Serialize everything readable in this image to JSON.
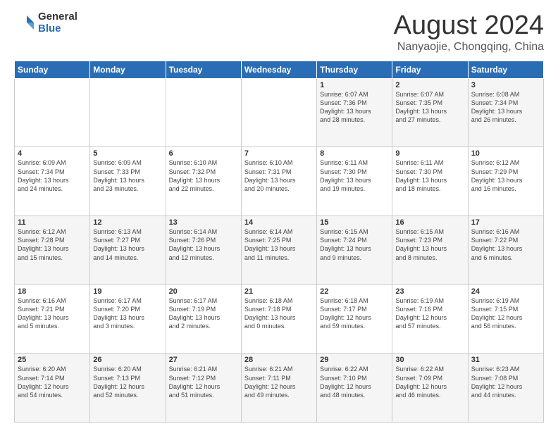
{
  "logo": {
    "general": "General",
    "blue": "Blue"
  },
  "header": {
    "month": "August 2024",
    "location": "Nanyaojie, Chongqing, China"
  },
  "weekdays": [
    "Sunday",
    "Monday",
    "Tuesday",
    "Wednesday",
    "Thursday",
    "Friday",
    "Saturday"
  ],
  "weeks": [
    [
      {
        "day": "",
        "info": ""
      },
      {
        "day": "",
        "info": ""
      },
      {
        "day": "",
        "info": ""
      },
      {
        "day": "",
        "info": ""
      },
      {
        "day": "1",
        "info": "Sunrise: 6:07 AM\nSunset: 7:36 PM\nDaylight: 13 hours\nand 28 minutes."
      },
      {
        "day": "2",
        "info": "Sunrise: 6:07 AM\nSunset: 7:35 PM\nDaylight: 13 hours\nand 27 minutes."
      },
      {
        "day": "3",
        "info": "Sunrise: 6:08 AM\nSunset: 7:34 PM\nDaylight: 13 hours\nand 26 minutes."
      }
    ],
    [
      {
        "day": "4",
        "info": "Sunrise: 6:09 AM\nSunset: 7:34 PM\nDaylight: 13 hours\nand 24 minutes."
      },
      {
        "day": "5",
        "info": "Sunrise: 6:09 AM\nSunset: 7:33 PM\nDaylight: 13 hours\nand 23 minutes."
      },
      {
        "day": "6",
        "info": "Sunrise: 6:10 AM\nSunset: 7:32 PM\nDaylight: 13 hours\nand 22 minutes."
      },
      {
        "day": "7",
        "info": "Sunrise: 6:10 AM\nSunset: 7:31 PM\nDaylight: 13 hours\nand 20 minutes."
      },
      {
        "day": "8",
        "info": "Sunrise: 6:11 AM\nSunset: 7:30 PM\nDaylight: 13 hours\nand 19 minutes."
      },
      {
        "day": "9",
        "info": "Sunrise: 6:11 AM\nSunset: 7:30 PM\nDaylight: 13 hours\nand 18 minutes."
      },
      {
        "day": "10",
        "info": "Sunrise: 6:12 AM\nSunset: 7:29 PM\nDaylight: 13 hours\nand 16 minutes."
      }
    ],
    [
      {
        "day": "11",
        "info": "Sunrise: 6:12 AM\nSunset: 7:28 PM\nDaylight: 13 hours\nand 15 minutes."
      },
      {
        "day": "12",
        "info": "Sunrise: 6:13 AM\nSunset: 7:27 PM\nDaylight: 13 hours\nand 14 minutes."
      },
      {
        "day": "13",
        "info": "Sunrise: 6:14 AM\nSunset: 7:26 PM\nDaylight: 13 hours\nand 12 minutes."
      },
      {
        "day": "14",
        "info": "Sunrise: 6:14 AM\nSunset: 7:25 PM\nDaylight: 13 hours\nand 11 minutes."
      },
      {
        "day": "15",
        "info": "Sunrise: 6:15 AM\nSunset: 7:24 PM\nDaylight: 13 hours\nand 9 minutes."
      },
      {
        "day": "16",
        "info": "Sunrise: 6:15 AM\nSunset: 7:23 PM\nDaylight: 13 hours\nand 8 minutes."
      },
      {
        "day": "17",
        "info": "Sunrise: 6:16 AM\nSunset: 7:22 PM\nDaylight: 13 hours\nand 6 minutes."
      }
    ],
    [
      {
        "day": "18",
        "info": "Sunrise: 6:16 AM\nSunset: 7:21 PM\nDaylight: 13 hours\nand 5 minutes."
      },
      {
        "day": "19",
        "info": "Sunrise: 6:17 AM\nSunset: 7:20 PM\nDaylight: 13 hours\nand 3 minutes."
      },
      {
        "day": "20",
        "info": "Sunrise: 6:17 AM\nSunset: 7:19 PM\nDaylight: 13 hours\nand 2 minutes."
      },
      {
        "day": "21",
        "info": "Sunrise: 6:18 AM\nSunset: 7:18 PM\nDaylight: 13 hours\nand 0 minutes."
      },
      {
        "day": "22",
        "info": "Sunrise: 6:18 AM\nSunset: 7:17 PM\nDaylight: 12 hours\nand 59 minutes."
      },
      {
        "day": "23",
        "info": "Sunrise: 6:19 AM\nSunset: 7:16 PM\nDaylight: 12 hours\nand 57 minutes."
      },
      {
        "day": "24",
        "info": "Sunrise: 6:19 AM\nSunset: 7:15 PM\nDaylight: 12 hours\nand 56 minutes."
      }
    ],
    [
      {
        "day": "25",
        "info": "Sunrise: 6:20 AM\nSunset: 7:14 PM\nDaylight: 12 hours\nand 54 minutes."
      },
      {
        "day": "26",
        "info": "Sunrise: 6:20 AM\nSunset: 7:13 PM\nDaylight: 12 hours\nand 52 minutes."
      },
      {
        "day": "27",
        "info": "Sunrise: 6:21 AM\nSunset: 7:12 PM\nDaylight: 12 hours\nand 51 minutes."
      },
      {
        "day": "28",
        "info": "Sunrise: 6:21 AM\nSunset: 7:11 PM\nDaylight: 12 hours\nand 49 minutes."
      },
      {
        "day": "29",
        "info": "Sunrise: 6:22 AM\nSunset: 7:10 PM\nDaylight: 12 hours\nand 48 minutes."
      },
      {
        "day": "30",
        "info": "Sunrise: 6:22 AM\nSunset: 7:09 PM\nDaylight: 12 hours\nand 46 minutes."
      },
      {
        "day": "31",
        "info": "Sunrise: 6:23 AM\nSunset: 7:08 PM\nDaylight: 12 hours\nand 44 minutes."
      }
    ]
  ]
}
